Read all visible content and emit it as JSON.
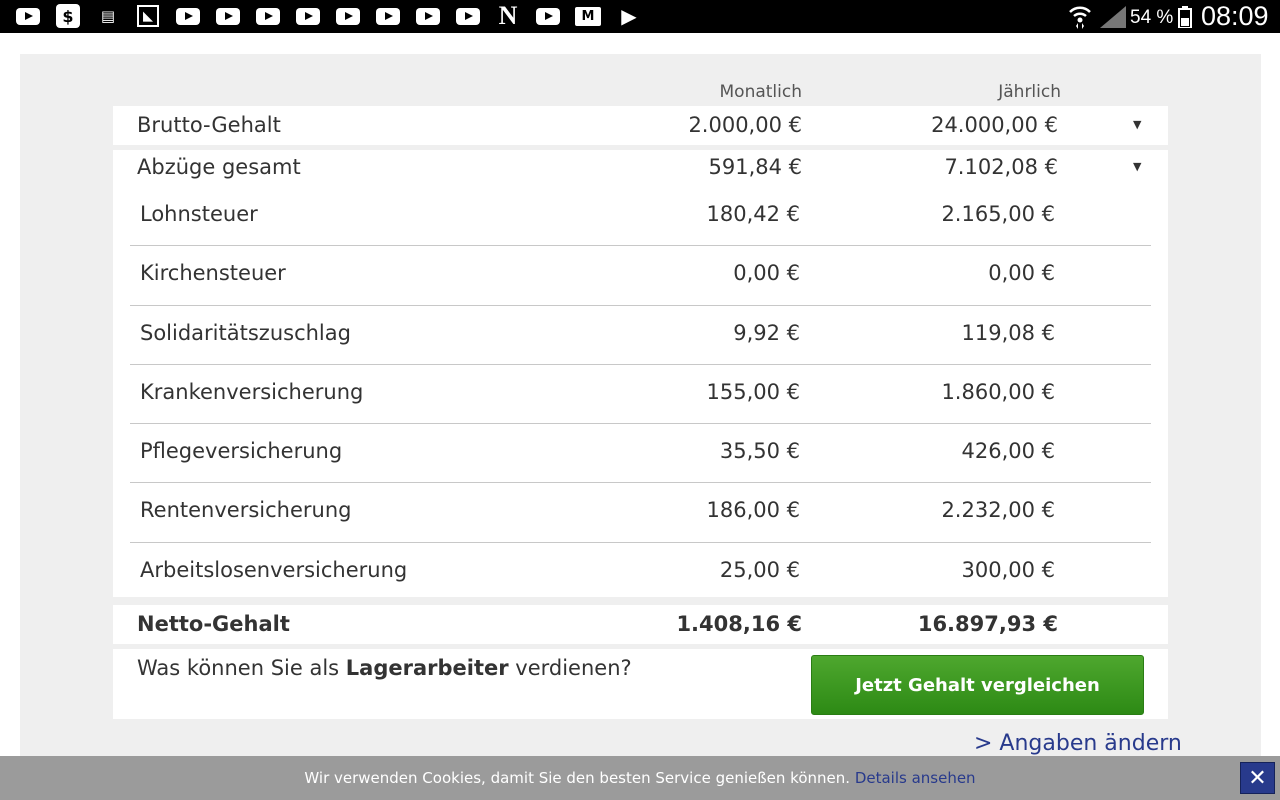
{
  "statusbar": {
    "battery": "54 %",
    "time": "08:09"
  },
  "table": {
    "col_monthly": "Monatlich",
    "col_yearly": "Jährlich",
    "gross": {
      "label": "Brutto-Gehalt",
      "monthly": "2.000,00 €",
      "yearly": "24.000,00 €"
    },
    "deductions": {
      "label": "Abzüge gesamt",
      "monthly": "591,84 €",
      "yearly": "7.102,08 €"
    },
    "items": [
      {
        "label": "Lohnsteuer",
        "monthly": "180,42 €",
        "yearly": "2.165,00 €"
      },
      {
        "label": "Kirchensteuer",
        "monthly": "0,00 €",
        "yearly": "0,00 €"
      },
      {
        "label": "Solidaritätszuschlag",
        "monthly": "9,92 €",
        "yearly": "119,08 €"
      },
      {
        "label": "Krankenversicherung",
        "monthly": "155,00 €",
        "yearly": "1.860,00 €"
      },
      {
        "label": "Pflegeversicherung",
        "monthly": "35,50 €",
        "yearly": "426,00 €"
      },
      {
        "label": "Rentenversicherung",
        "monthly": "186,00 €",
        "yearly": "2.232,00 €"
      },
      {
        "label": "Arbeitslosenversicherung",
        "monthly": "25,00 €",
        "yearly": "300,00 €"
      }
    ],
    "net": {
      "label": "Netto-Gehalt",
      "monthly": "1.408,16 €",
      "yearly": "16.897,93 €"
    }
  },
  "compare": {
    "prefix": "Was können Sie als ",
    "job": "Lagerarbeiter",
    "suffix": " verdienen?",
    "button": "Jetzt Gehalt vergleichen"
  },
  "change_link": "> Angaben ändern",
  "cookie": {
    "text": "Wir verwenden Cookies, damit Sie den besten Service genießen können.",
    "link": "Details ansehen",
    "close": "✕"
  },
  "colors": {
    "button_green": "#3a9a20",
    "link_blue": "#283a8c",
    "cookie_bg": "#9b9b9b"
  }
}
